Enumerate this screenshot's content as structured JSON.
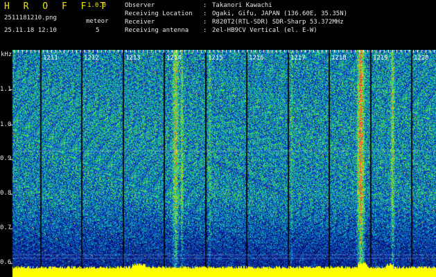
{
  "app": {
    "title": "H R O F F T",
    "version": "1.0.0",
    "filename": "2511181210.png",
    "datetime": "25.11.18 12:10",
    "meteor_label": "meteor",
    "meteor_count": "5"
  },
  "info": [
    {
      "key": "Observer",
      "value": "Takanori Kawachi"
    },
    {
      "key": "Receiving Location",
      "value": "Ogaki, Gifu, JAPAN (136.60E, 35.35N)"
    },
    {
      "key": "Receiver",
      "value": "R820T2(RTL-SDR) SDR-Sharp 53.372MHz"
    },
    {
      "key": "Receiving antenna",
      "value": "2el-HB9CV Vertical (el. E-W)"
    }
  ],
  "separator": ":",
  "axis": {
    "unit": "kHz",
    "y_ticks": [
      "1.1",
      "1.0",
      "0.9",
      "0.8",
      "0.7",
      "0.6"
    ],
    "time_ticks": [
      "1211",
      "1212",
      "1213",
      "1214",
      "1215",
      "1216",
      "1217",
      "1218",
      "1219",
      "1220"
    ]
  },
  "colors": {
    "background": "#000000",
    "label_yellow": "#f2e600",
    "meteor_green": "#29c829",
    "spectrum_low": "#0a1f8c",
    "spectrum_high": "#e0202a",
    "baseline_yellow": "#ffff00"
  }
}
